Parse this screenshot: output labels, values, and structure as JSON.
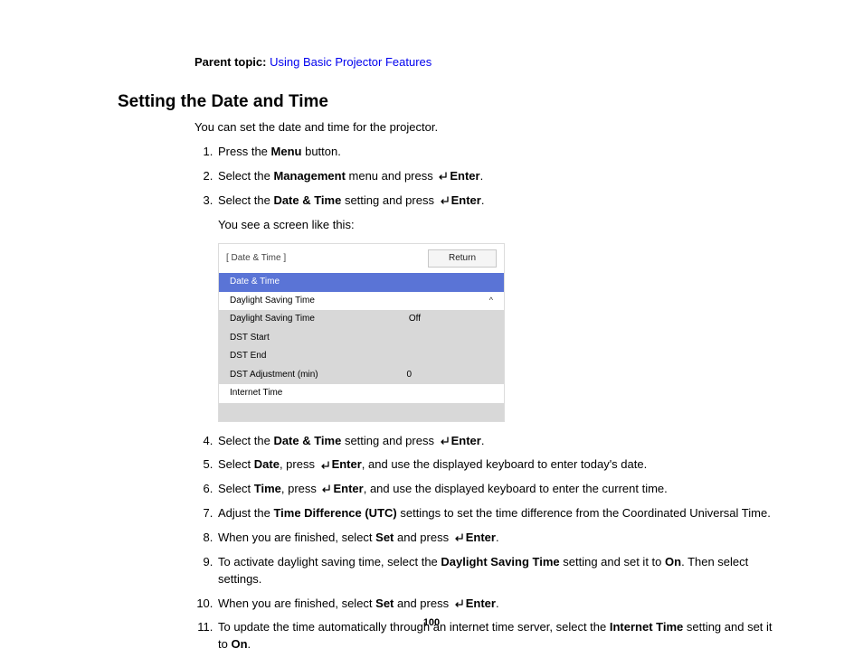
{
  "parent_label": "Parent topic:",
  "parent_link": "Using Basic Projector Features",
  "heading": "Setting the Date and Time",
  "intro": "You can set the date and time for the projector.",
  "steps": {
    "s1": {
      "pre": "Press the ",
      "b1": "Menu",
      "post": " button."
    },
    "s2": {
      "pre": "Select the ",
      "b1": "Management",
      "mid": " menu and press ",
      "b2": "Enter",
      "post": "."
    },
    "s3": {
      "pre": "Select the ",
      "b1": "Date & Time",
      "mid": " setting and press ",
      "b2": "Enter",
      "post": ".",
      "sub": "You see a screen like this:"
    },
    "s4": {
      "pre": "Select the ",
      "b1": "Date & Time",
      "mid": " setting and press ",
      "b2": "Enter",
      "post": "."
    },
    "s5": {
      "pre": "Select ",
      "b1": "Date",
      "mid": ", press ",
      "b2": "Enter",
      "post": ", and use the displayed keyboard to enter today's date."
    },
    "s6": {
      "pre": "Select ",
      "b1": "Time",
      "mid": ", press ",
      "b2": "Enter",
      "post": ", and use the displayed keyboard to enter the current time."
    },
    "s7": {
      "pre": "Adjust the ",
      "b1": "Time Difference (UTC)",
      "post": " settings to set the time difference from the Coordinated Universal Time."
    },
    "s8": {
      "pre": "When you are finished, select ",
      "b1": "Set",
      "mid": " and press ",
      "b2": "Enter",
      "post": "."
    },
    "s9": {
      "pre": "To activate daylight saving time, select the ",
      "b1": "Daylight Saving Time",
      "mid": " setting and set it to ",
      "b2": "On",
      "post": ". Then select settings."
    },
    "s10": {
      "pre": "When you are finished, select ",
      "b1": "Set",
      "mid": " and press ",
      "b2": "Enter",
      "post": "."
    },
    "s11": {
      "pre": "To update the time automatically through an internet time server, select the ",
      "b1": "Internet Time",
      "mid": " setting and set it to ",
      "b2": "On",
      "post": "."
    }
  },
  "menu": {
    "title": "[ Date & Time ]",
    "return": "Return",
    "rows": {
      "r1": "Date & Time",
      "r2": {
        "label": "Daylight Saving Time"
      },
      "r3": {
        "label": "Daylight Saving Time",
        "value": "Off"
      },
      "r4": {
        "label": "DST Start"
      },
      "r5": {
        "label": "DST End"
      },
      "r6": {
        "label": "DST Adjustment (min)",
        "value": "0"
      },
      "r7": {
        "label": "Internet Time"
      }
    }
  },
  "page_num": "100"
}
